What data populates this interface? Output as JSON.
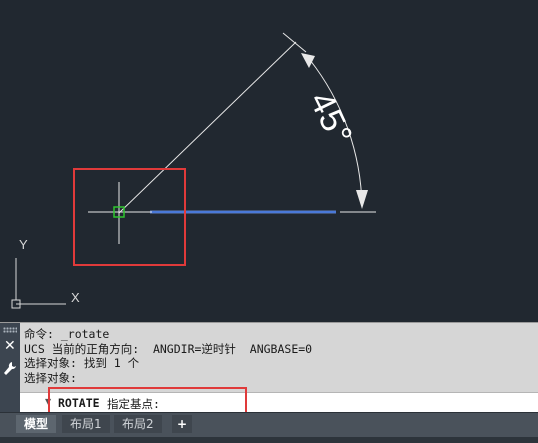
{
  "canvas": {
    "dimension_text": "45°",
    "ucs": {
      "x_label": "X",
      "y_label": "Y"
    }
  },
  "command_window": {
    "history": [
      "命令: _rotate",
      "UCS 当前的正角方向:  ANGDIR=逆时针  ANGBASE=0",
      "选择对象: 找到 1 个",
      "选择对象:"
    ],
    "prompt": {
      "command": "ROTATE",
      "ask": "指定基点:"
    }
  },
  "tabs": [
    {
      "label": "模型",
      "active": true
    },
    {
      "label": "布局1",
      "active": false
    },
    {
      "label": "布局2",
      "active": false
    },
    {
      "label": "+",
      "active": false
    }
  ],
  "colors": {
    "canvas_bg": "#212830",
    "highlight": "#e03a3a",
    "selected_line": "#4a79d8"
  }
}
